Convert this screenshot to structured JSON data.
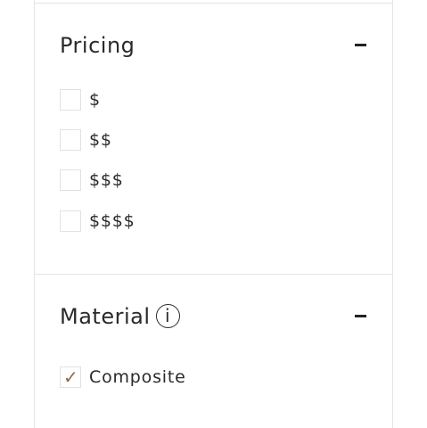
{
  "pricing": {
    "title": "Pricing",
    "options": [
      {
        "label": "$",
        "checked": false
      },
      {
        "label": "$$",
        "checked": false
      },
      {
        "label": "$$$",
        "checked": false
      },
      {
        "label": "$$$$",
        "checked": false
      }
    ]
  },
  "material": {
    "title": "Material",
    "info_icon_glyph": "i",
    "options": [
      {
        "label": "Composite",
        "checked": true,
        "check_glyph": "✓"
      }
    ]
  },
  "colors": {
    "checkmark": "#8a6a52",
    "border": "#e4e4e4"
  },
  "icons": {
    "collapse": "minus-icon",
    "info": "info-icon"
  }
}
